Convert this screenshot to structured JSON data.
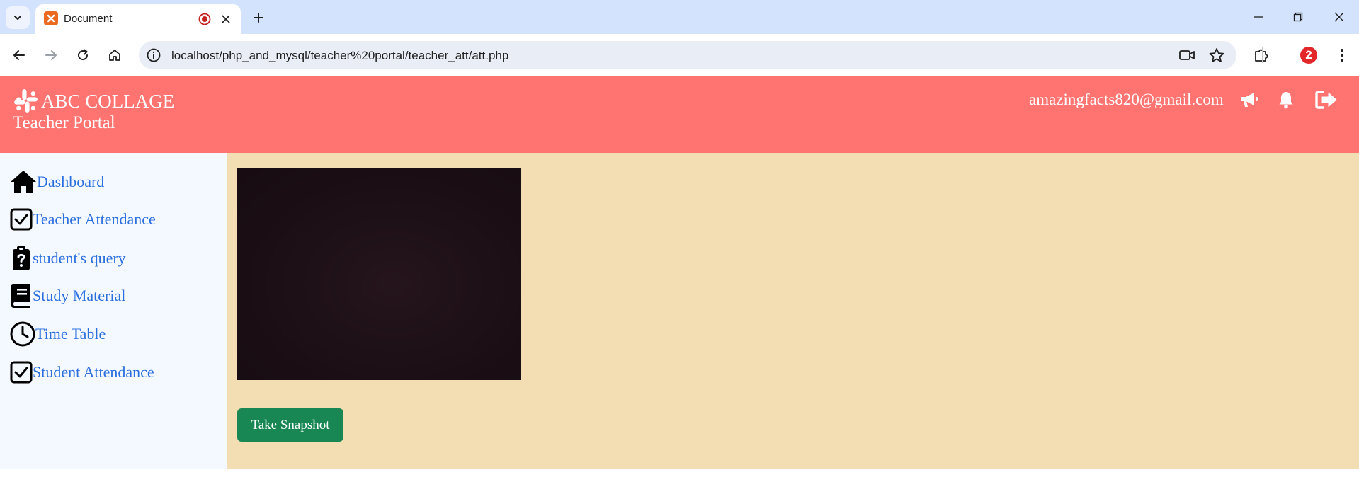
{
  "browser": {
    "tab": {
      "title": "Document"
    },
    "address_bar": {
      "url": "localhost/php_and_mysql/teacher%20portal/teacher_att/att.php"
    },
    "extension_badge": "2",
    "icons": {
      "tab_list": "chevron-down-icon",
      "favicon": "xampp-icon",
      "recording": "recording-icon",
      "tab_close": "close-icon",
      "new_tab": "plus-icon",
      "minimize": "minimize-icon",
      "restore": "restore-icon",
      "close_window": "close-icon",
      "back": "arrow-left-icon",
      "forward": "arrow-right-icon",
      "reload": "reload-icon",
      "home": "home-icon",
      "site_info": "info-icon",
      "camera_in_use": "video-camera-icon",
      "bookmark": "star-icon",
      "extensions": "puzzle-icon",
      "menu": "more-vertical-icon"
    }
  },
  "header": {
    "brand_name": "ABC COLLAGE",
    "subtitle": "Teacher Portal",
    "user_email": "amazingfacts820@gmail.com",
    "icons": [
      "slack-logo-icon",
      "megaphone-icon",
      "bell-icon",
      "sign-out-icon"
    ],
    "background_color": "#ff7370"
  },
  "sidebar": {
    "items": [
      {
        "label": "Dashboard",
        "icon": "home-icon"
      },
      {
        "label": "Teacher Attendance",
        "icon": "checkbox-icon"
      },
      {
        "label": "student's query",
        "icon": "clipboard-question-icon"
      },
      {
        "label": "Study Material",
        "icon": "book-icon"
      },
      {
        "label": "Time Table",
        "icon": "clock-icon"
      },
      {
        "label": "Student Attendance",
        "icon": "checkbox-icon"
      }
    ],
    "link_color": "#2b6fe0"
  },
  "main": {
    "camera_feed": "webcam-video",
    "snapshot_button": "Take Snapshot",
    "background_color": "#f3ddb3",
    "button_color": "#198754"
  }
}
